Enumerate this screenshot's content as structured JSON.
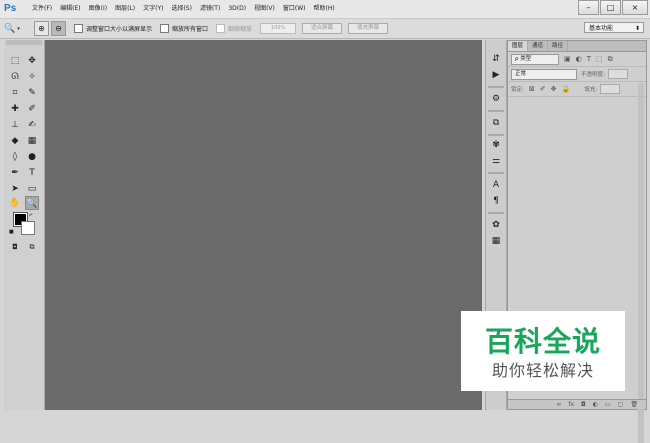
{
  "app": {
    "logo": "Ps"
  },
  "menus": [
    "文件(F)",
    "编辑(E)",
    "图像(I)",
    "图层(L)",
    "文字(Y)",
    "选择(S)",
    "滤镜(T)",
    "3D(D)",
    "视图(V)",
    "窗口(W)",
    "帮助(H)"
  ],
  "window_controls": {
    "minimize": "–",
    "maximize": "□",
    "close": "×"
  },
  "options_bar": {
    "resize_windows_label": "调整窗口大小以满屏显示",
    "zoom_all_label": "缩放所有窗口",
    "scrubby_zoom_label": "细微缩放",
    "zoom_value": "100%",
    "fit_screen_label": "适合屏幕",
    "fill_screen_label": "填充屏幕",
    "workspace": "基本功能"
  },
  "panel": {
    "tabs": [
      "图层",
      "通道",
      "路径"
    ],
    "filter_kind": "ρ 类型",
    "blend_mode": "正常",
    "opacity_label": "不透明度:",
    "lock_label": "锁定:",
    "fill_label": "填充:"
  },
  "colors": {
    "foreground": "#000000",
    "background": "#ffffff",
    "canvas": "#6b6b6b"
  },
  "watermark": {
    "title": "百科全说",
    "subtitle": "助你轻松解决"
  }
}
